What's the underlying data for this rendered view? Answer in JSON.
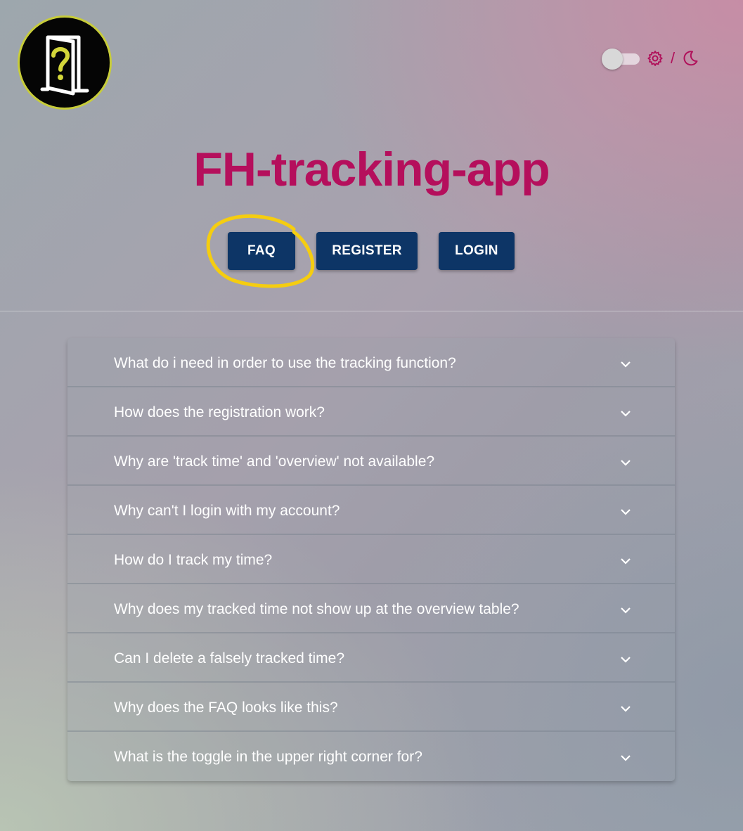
{
  "header": {
    "logo": {
      "icon": "question-door-icon",
      "ring_color": "#c7cc3a",
      "symbol_color": "#d3d63a"
    },
    "theme_switch": {
      "state": "off",
      "light_icon": "gear-icon",
      "separator": "/",
      "dark_icon": "moon-icon",
      "icon_color": "#b0105a"
    }
  },
  "title": "FH-tracking-app",
  "title_color": "#b50f5c",
  "nav": {
    "faq_label": "FAQ",
    "register_label": "REGISTER",
    "login_label": "LOGIN",
    "button_color": "#0d3566",
    "highlight": "faq",
    "highlight_color": "#f5cd10"
  },
  "faq": {
    "items": [
      {
        "question": "What do i need in order to use the tracking function?"
      },
      {
        "question": "How does the registration work?"
      },
      {
        "question": "Why are 'track time' and 'overview' not available?"
      },
      {
        "question": "Why can't I login with my account?"
      },
      {
        "question": "How do I track my time?"
      },
      {
        "question": "Why does my tracked time not show up at the overview table?"
      },
      {
        "question": "Can I delete a falsely tracked time?"
      },
      {
        "question": "Why does the FAQ looks like this?"
      },
      {
        "question": "What is the toggle in the upper right corner for?"
      }
    ],
    "expand_icon": "chevron-down-icon"
  }
}
